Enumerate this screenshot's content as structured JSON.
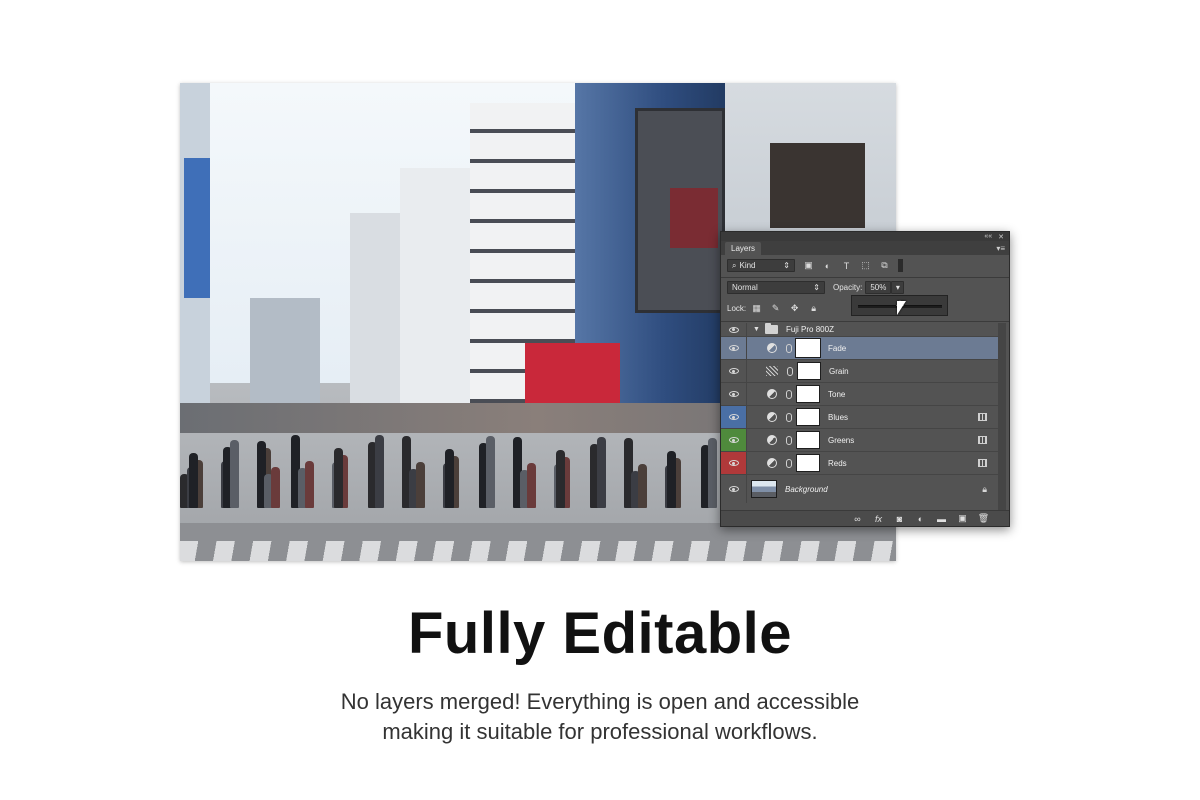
{
  "layers_panel": {
    "tab_label": "Layers",
    "collapse_glyph": "««",
    "close_glyph": "✕",
    "menu_glyph": "▾≡",
    "filter_label": "Kind",
    "blend_mode": "Normal",
    "opacity_label": "Opacity:",
    "opacity_value": "50%",
    "opacity_fraction": 0.5,
    "lock_label": "Lock:",
    "group": {
      "name": "Fuji Pro 800Z"
    },
    "layers": [
      {
        "name": "Fade",
        "type": "adjustment",
        "selected": true,
        "color_tag": "",
        "has_badge": false
      },
      {
        "name": "Grain",
        "type": "grain",
        "selected": false,
        "color_tag": "",
        "has_badge": false
      },
      {
        "name": "Tone",
        "type": "adjustment",
        "selected": false,
        "color_tag": "",
        "has_badge": false
      },
      {
        "name": "Blues",
        "type": "adjustment",
        "selected": false,
        "color_tag": "#4a6fa5",
        "has_badge": true
      },
      {
        "name": "Greens",
        "type": "adjustment",
        "selected": false,
        "color_tag": "#4f8a3c",
        "has_badge": true
      },
      {
        "name": "Reds",
        "type": "adjustment",
        "selected": false,
        "color_tag": "#b0393a",
        "has_badge": true
      }
    ],
    "background_layer": {
      "name": "Background"
    },
    "footer_icons": [
      "link-icon",
      "fx-icon",
      "mask-icon",
      "adjustment-icon",
      "folder-icon",
      "new-layer-icon",
      "trash-icon"
    ]
  },
  "headline": "Fully Editable",
  "subline": {
    "line1": "No layers merged! Everything is open and accessible",
    "line2": "making it suitable for professional workflows."
  }
}
